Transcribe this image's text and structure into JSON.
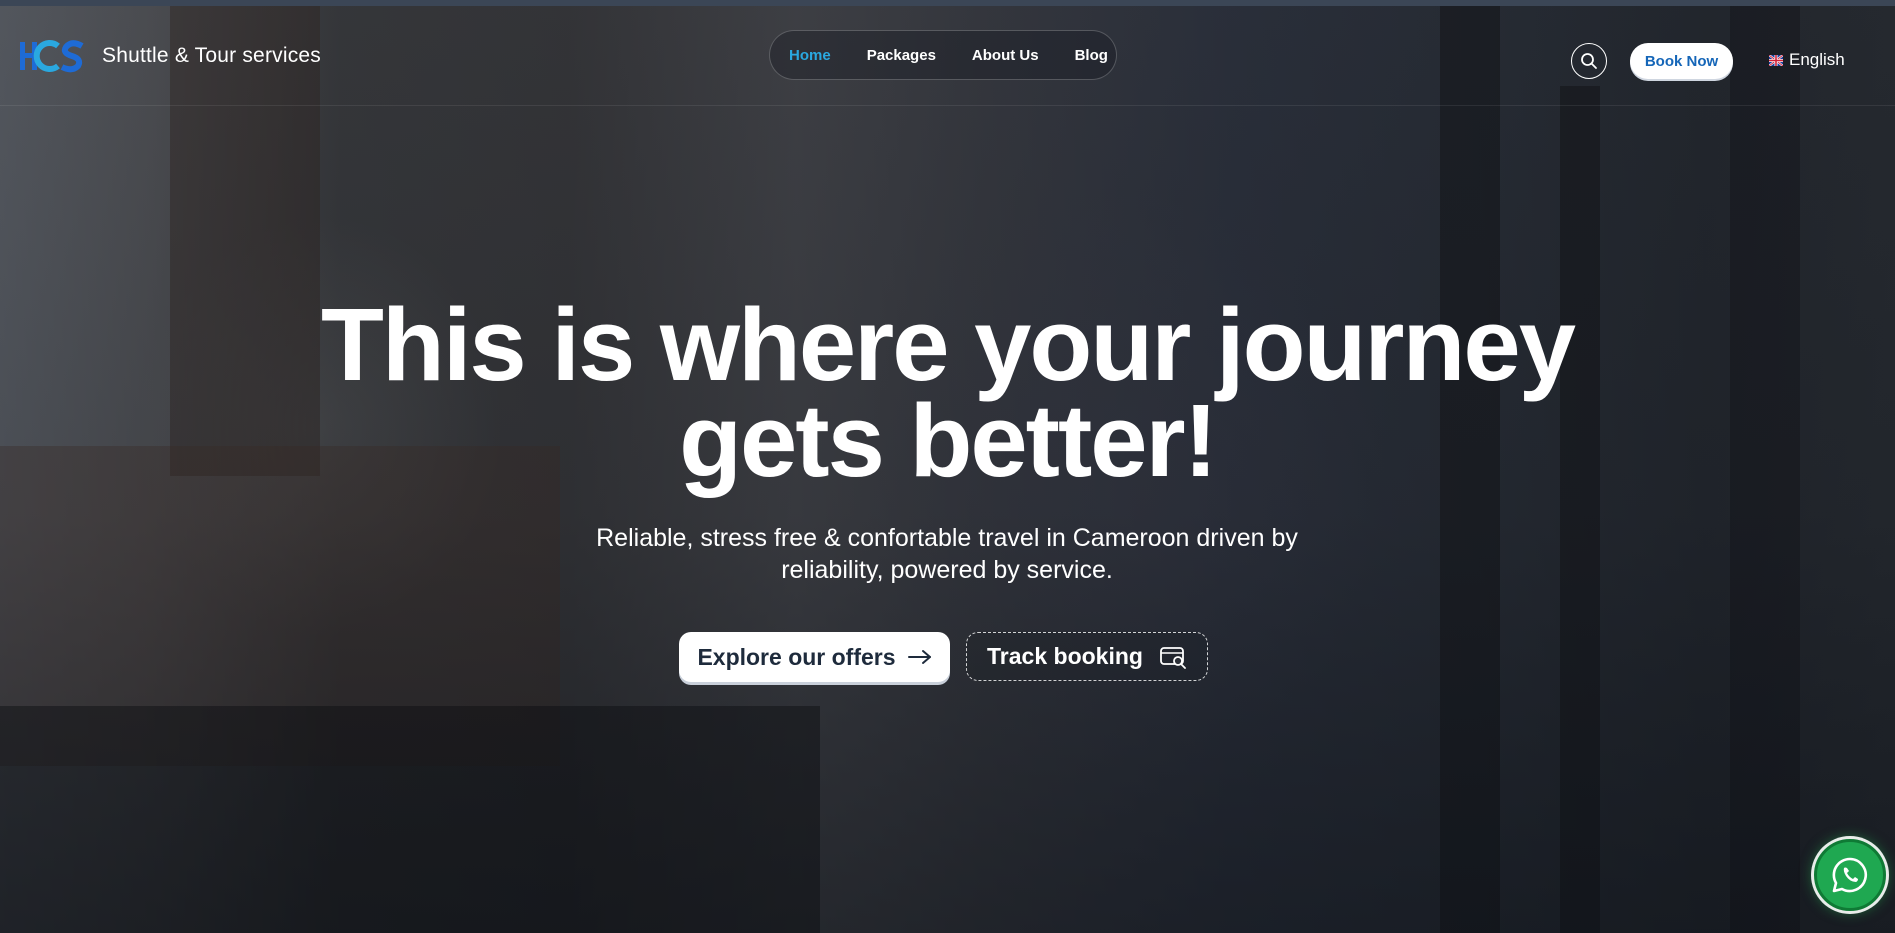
{
  "header": {
    "brand_name": "Shuttle & Tour services",
    "logo_text": "HCS",
    "nav": [
      {
        "label": "Home",
        "active": true
      },
      {
        "label": "Packages",
        "active": false
      },
      {
        "label": "About Us",
        "active": false
      },
      {
        "label": "Blog",
        "active": false
      }
    ],
    "search_icon": "search-icon",
    "book_label": "Book Now",
    "language": "English",
    "language_flag": "uk-flag-icon"
  },
  "hero": {
    "headline_line1": "This is where your journey",
    "headline_line2": "gets better!",
    "subline_line1": "Reliable, stress free & confortable travel in Cameroon driven by",
    "subline_line2": "reliability, powered by service.",
    "primary_cta": "Explore our offers",
    "secondary_cta": "Track booking"
  },
  "floating": {
    "whatsapp_icon": "whatsapp-icon"
  },
  "colors": {
    "accent": "#2aa8e0",
    "book_text": "#1566b8",
    "logo_blue": "#1e6bd6",
    "whatsapp": "#1fa851"
  }
}
